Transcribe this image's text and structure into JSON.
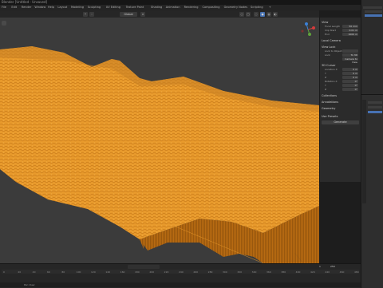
{
  "window": {
    "title": "Blender [Untitled - Unsaved]"
  },
  "menubar": {
    "items": [
      "File",
      "Edit",
      "Render",
      "Window",
      "Help",
      "Layout",
      "Modeling",
      "Sculpting",
      "UV Editing",
      "Texture Paint",
      "Shading",
      "Animation",
      "Rendering",
      "Compositing",
      "Geometry Nodes",
      "Scripting",
      "+"
    ]
  },
  "viewport_header": {
    "mode": "Object Mode",
    "transform_space": "Global"
  },
  "npanel": {
    "tabs": [
      "Item",
      "Tool",
      "View"
    ],
    "sections": [
      {
        "title": "View",
        "rows": [
          {
            "label": "Focal Length",
            "value": "50 mm"
          },
          {
            "label": "Clip Start",
            "value": "0.01 m"
          },
          {
            "label": "End",
            "value": "1000 m"
          }
        ]
      },
      {
        "title": "Local Camera",
        "rows": []
      },
      {
        "title": "View Lock",
        "rows": [
          {
            "label": "Lock to Object",
            "value": ""
          },
          {
            "label": "Lock",
            "value": "To 3D Cursor"
          },
          {
            "label": "",
            "value": "Camera to View"
          }
        ]
      },
      {
        "title": "3D Cursor",
        "rows": [
          {
            "label": "Location X",
            "value": "0 m"
          },
          {
            "label": "Y",
            "value": "0 m"
          },
          {
            "label": "Z",
            "value": "0 m"
          },
          {
            "label": "Rotation X",
            "value": "0°"
          },
          {
            "label": "Y",
            "value": "0°"
          },
          {
            "label": "Z",
            "value": "0°"
          }
        ]
      },
      {
        "title": "Collections",
        "rows": []
      },
      {
        "title": "Annotations",
        "rows": []
      },
      {
        "title": "Geometry",
        "rows": []
      }
    ],
    "generate_button": "Generate",
    "option": "Use Presets"
  },
  "timeline": {
    "frame_start": "1",
    "frame_end": "250",
    "current_frame": "1",
    "ticks": [
      "0",
      "20",
      "40",
      "60",
      "80",
      "100",
      "120",
      "140",
      "160",
      "180",
      "200",
      "220",
      "240",
      "260",
      "280",
      "300",
      "320",
      "340",
      "360",
      "380",
      "400",
      "420",
      "440",
      "460",
      "480"
    ]
  },
  "statusbar": {
    "text": "Pan View"
  },
  "colors": {
    "terrain": "#e89a2c",
    "terrain_shadow": "#a8620f",
    "viewport_bg": "#3b3b3b",
    "panel_bg": "#2b2b2b",
    "accent": "#4772b3"
  }
}
